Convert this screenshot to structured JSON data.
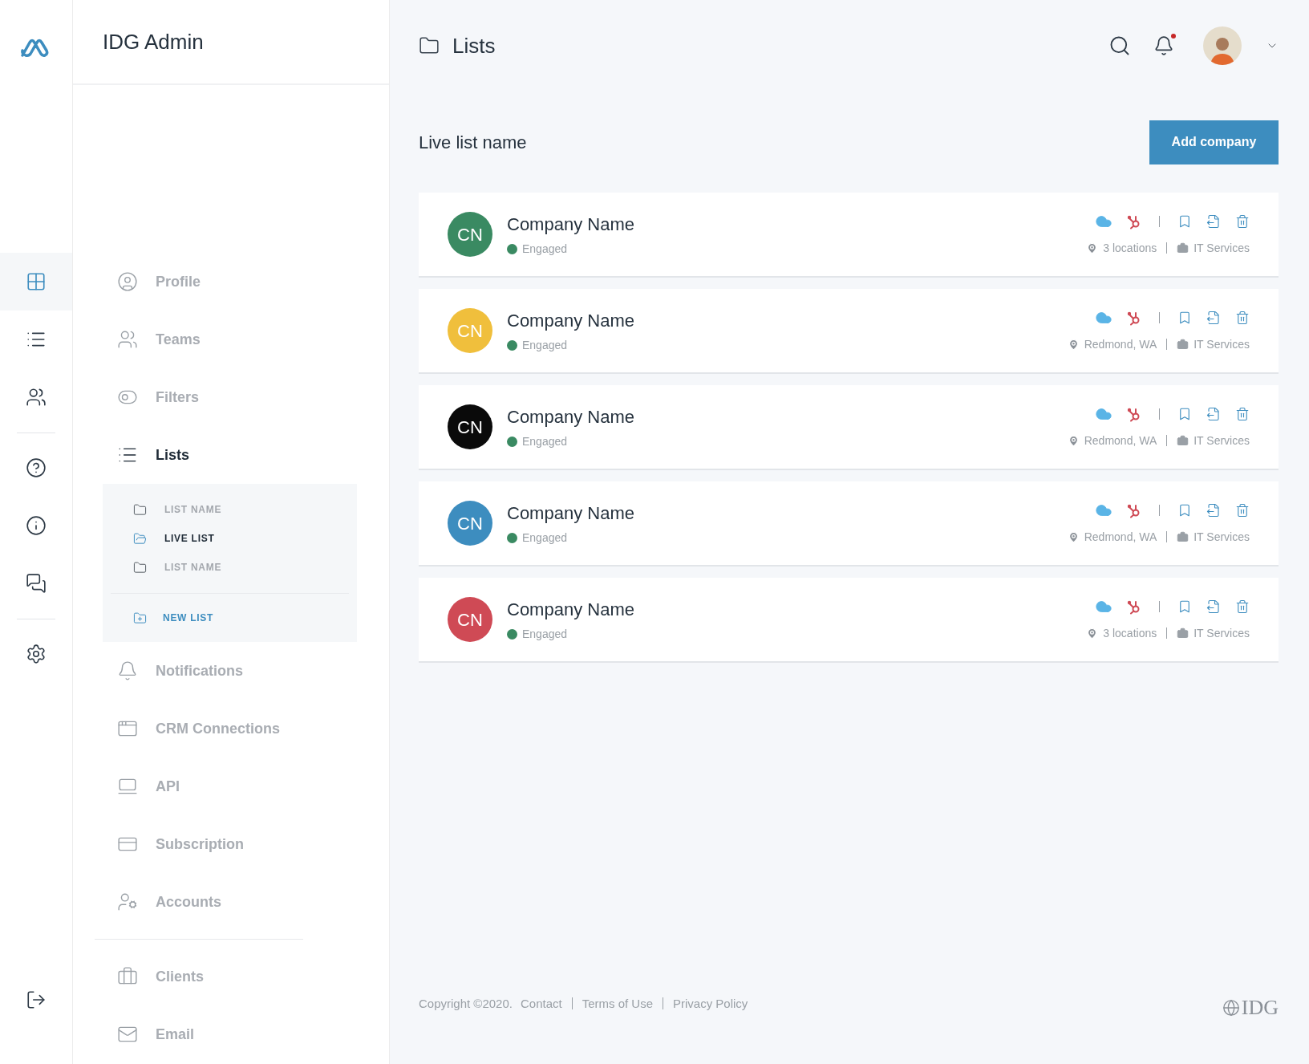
{
  "app": {
    "title": "IDG Admin"
  },
  "rail": [
    {
      "kind": "logo"
    },
    {
      "kind": "spacer"
    },
    {
      "kind": "button",
      "selected": true
    },
    {
      "kind": "button",
      "selected": false
    },
    {
      "kind": "button",
      "selected": false
    },
    {
      "kind": "divider"
    },
    {
      "kind": "button",
      "selected": false
    },
    {
      "kind": "button",
      "selected": false
    },
    {
      "kind": "button",
      "selected": false
    },
    {
      "kind": "divider"
    },
    {
      "kind": "button",
      "selected": false
    },
    {
      "kind": "spacer"
    },
    {
      "kind": "button",
      "selected": false
    }
  ],
  "sidebar": {
    "sections": [
      {
        "items": [
          {
            "label": "Profile",
            "selected": false
          },
          {
            "label": "Teams",
            "selected": false
          },
          {
            "label": "Filters",
            "selected": false
          },
          {
            "label": "Lists",
            "selected": true,
            "children": [
              {
                "label": "LIST NAME",
                "selected": false
              },
              {
                "label": "LIVE LIST",
                "selected": true
              },
              {
                "label": "LIST NAME",
                "selected": false
              }
            ],
            "new_item": "NEW LIST"
          },
          {
            "label": "Notifications",
            "selected": false
          },
          {
            "label": "CRM Connections",
            "selected": false
          },
          {
            "label": "API",
            "selected": false
          },
          {
            "label": "Subscription",
            "selected": false
          },
          {
            "label": "Accounts",
            "selected": false
          }
        ]
      },
      {
        "items": [
          {
            "label": "Clients",
            "selected": false
          },
          {
            "label": "Email",
            "selected": false
          }
        ]
      }
    ]
  },
  "header": {
    "title": "Lists",
    "notification_unread": true
  },
  "list": {
    "title": "Live list name",
    "add_button": "Add company",
    "companies": [
      {
        "initials": "CN",
        "color": "#3a8a62",
        "name": "Company Name",
        "status": "Engaged",
        "location": "3 locations",
        "industry": "IT Services"
      },
      {
        "initials": "CN",
        "color": "#f0bf3c",
        "name": "Company Name",
        "status": "Engaged",
        "location": "Redmond, WA",
        "industry": "IT Services"
      },
      {
        "initials": "CN",
        "color": "#0a0a0a",
        "name": "Company Name",
        "status": "Engaged",
        "location": "Redmond, WA",
        "industry": "IT Services"
      },
      {
        "initials": "CN",
        "color": "#3d8dbf",
        "name": "Company Name",
        "status": "Engaged",
        "location": "Redmond, WA",
        "industry": "IT Services"
      },
      {
        "initials": "CN",
        "color": "#cf4a55",
        "name": "Company Name",
        "status": "Engaged",
        "location": "3 locations",
        "industry": "IT Services"
      }
    ]
  },
  "footer": {
    "copyright": "Copyright ©2020.",
    "links": [
      "Contact",
      "Terms of Use",
      "Privacy Policy"
    ],
    "logo": "IDG"
  }
}
